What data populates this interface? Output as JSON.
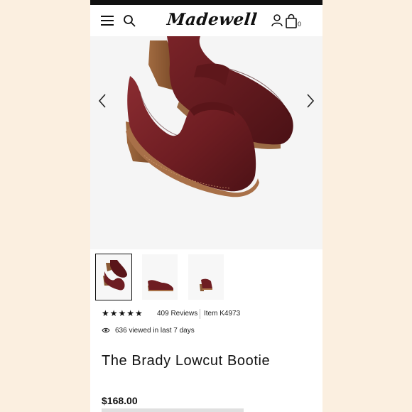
{
  "header": {
    "logo_text": "Madewell",
    "bag_count": "0",
    "icons": [
      "menu-icon",
      "search-icon",
      "account-icon",
      "bag-icon"
    ]
  },
  "gallery": {
    "main_image": "brady-lowcut-bootie-burgundy",
    "thumbnails": [
      "brady-bootie-pair",
      "brady-bootie-side",
      "brady-bootie-back"
    ],
    "selected_index": 0
  },
  "product": {
    "rating": 5,
    "reviews_text": "409 Reviews",
    "item_number": "Item K4973",
    "views_text": "636 viewed in last 7 days",
    "title": "The Brady Lowcut Bootie",
    "price": "$168.00"
  },
  "colors": {
    "background": "#fbefe0",
    "leather": "#6e1d22",
    "heel": "#8a5a35",
    "text": "#111111"
  }
}
